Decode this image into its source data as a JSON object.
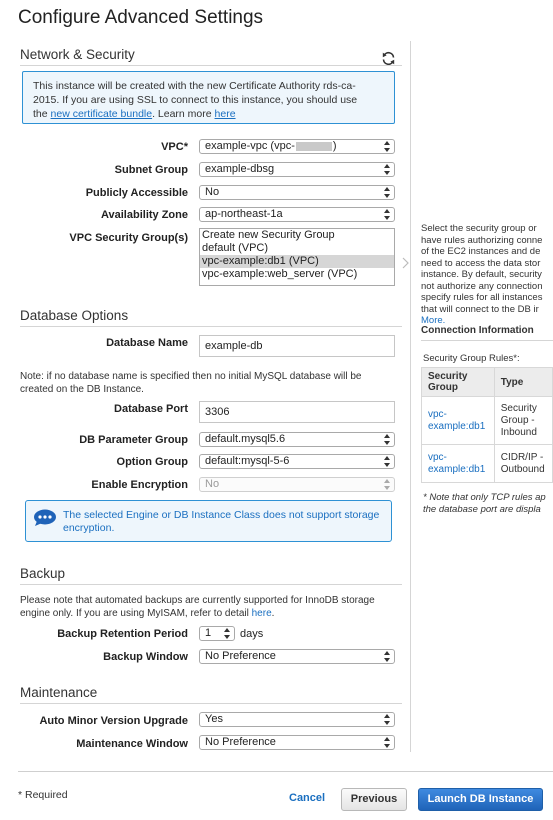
{
  "page_title": "Configure Advanced Settings",
  "network": {
    "title": "Network & Security",
    "info": {
      "line1": "This instance will be created with the new Certificate Authority rds-ca-",
      "line2": "2015. If you are using SSL to connect to this instance, you should use",
      "the": "the ",
      "link1": "new certificate bundle",
      "learn": ". Learn more ",
      "link2": "here"
    },
    "vpc": {
      "label": "VPC*",
      "value_prefix": "example-vpc (vpc-",
      "value_suffix": ")"
    },
    "subnet": {
      "label": "Subnet Group",
      "value": "example-dbsg"
    },
    "public": {
      "label": "Publicly Accessible",
      "value": "No"
    },
    "az": {
      "label": "Availability Zone",
      "value": "ap-northeast-1a"
    },
    "sg": {
      "label": "VPC Security Group(s)",
      "options": [
        "Create new Security Group",
        "default (VPC)",
        "vpc-example:db1 (VPC)",
        "vpc-example:web_server (VPC)"
      ]
    }
  },
  "database": {
    "title": "Database Options",
    "name": {
      "label": "Database Name",
      "value": "example-db"
    },
    "note1": "Note: if no database name is specified then no initial MySQL database will be",
    "note2": "created on the DB Instance.",
    "port": {
      "label": "Database Port",
      "value": "3306"
    },
    "param": {
      "label": "DB Parameter Group",
      "value": "default.mysql5.6"
    },
    "option": {
      "label": "Option Group",
      "value": "default:mysql-5-6"
    },
    "encrypt": {
      "label": "Enable Encryption",
      "value": "No"
    },
    "warn1": "The selected Engine or DB Instance Class does not support storage",
    "warn2": "encryption."
  },
  "backup": {
    "title": "Backup",
    "note1": "Please note that automated backups are currently supported for InnoDB storage",
    "note2": "engine only. If you are using MyISAM, refer to detail ",
    "note_link": "here",
    "note_end": ".",
    "retention": {
      "label": "Backup Retention Period",
      "value": "1",
      "unit": "days"
    },
    "window": {
      "label": "Backup Window",
      "value": "No Preference"
    }
  },
  "maintenance": {
    "title": "Maintenance",
    "auto": {
      "label": "Auto Minor Version Upgrade",
      "value": "Yes"
    },
    "window": {
      "label": "Maintenance Window",
      "value": "No Preference"
    }
  },
  "side": {
    "lines": [
      "Select the security group or",
      "have rules authorizing conne",
      "of the EC2 instances and de",
      "need to access the data stor",
      "instance. By default, security",
      "not authorize any connection",
      "specify rules for all instances",
      "that will connect to the DB ir"
    ],
    "more": "More.",
    "conn_title": "Connection Information",
    "rules_label": "Security Group Rules*:",
    "table": {
      "h1a": "Security",
      "h1b": "Group",
      "h2": "Type",
      "r1c1a": "vpc-",
      "r1c1b": "example:db1",
      "r1c2a": "Security",
      "r1c2b": "Group -",
      "r1c2c": "Inbound",
      "r2c1a": "vpc-",
      "r2c1b": "example:db1",
      "r2c2a": "CIDR/IP -",
      "r2c2b": "Outbound"
    },
    "foot1": "* Note that only TCP rules ap",
    "foot2": "the database port are displa"
  },
  "footer": {
    "required": "* Required",
    "cancel": "Cancel",
    "previous": "Previous",
    "launch": "Launch DB Instance"
  }
}
